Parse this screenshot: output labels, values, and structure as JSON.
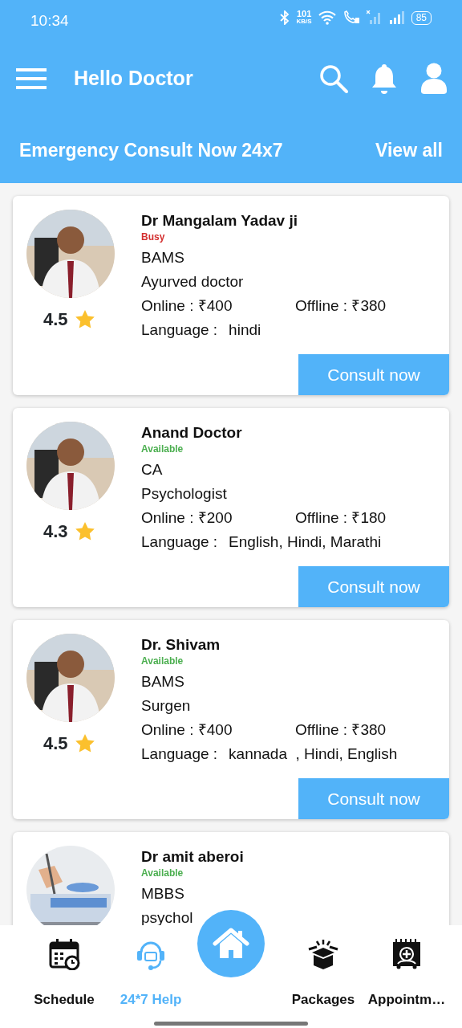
{
  "status_bar": {
    "time": "10:34",
    "speed_value": "101",
    "speed_unit": "KB/S",
    "battery": "85"
  },
  "app_bar": {
    "title": "Hello Doctor"
  },
  "section": {
    "title": "Emergency Consult Now 24x7",
    "link": "View all"
  },
  "doctors": [
    {
      "name": "Dr Mangalam Yadav ji",
      "status": {
        "label": "Busy",
        "color": "#d32f2f"
      },
      "degree": "BAMS",
      "specialty": "Ayurved doctor",
      "online_fee": "Online : ₹400",
      "offline_fee": "Offline : ₹380",
      "language_label": "Language :",
      "languages": "hindi",
      "rating": "4.5",
      "button": "Consult now"
    },
    {
      "name": "Anand Doctor",
      "status": {
        "label": "Available",
        "color": "#4caf50"
      },
      "degree": "CA",
      "specialty": "Psychologist",
      "online_fee": "Online : ₹200",
      "offline_fee": "Offline : ₹180",
      "language_label": "Language :",
      "languages": "English, Hindi, Marathi",
      "rating": "4.3",
      "button": "Consult now"
    },
    {
      "name": "Dr. Shivam",
      "status": {
        "label": "Available",
        "color": "#4caf50"
      },
      "degree": "BAMS",
      "specialty": "Surgen",
      "online_fee": "Online : ₹400",
      "offline_fee": "Offline : ₹380",
      "language_label": "Language :",
      "languages": "kannada  , Hindi, English",
      "rating": "4.5",
      "button": "Consult now"
    },
    {
      "name": "Dr amit aberoi",
      "status": {
        "label": "Available",
        "color": "#4caf50"
      },
      "degree": "MBBS",
      "specialty": "psychol"
    }
  ],
  "bottom_nav": [
    {
      "label": "Schedule",
      "selected": false
    },
    {
      "label": "24*7 Help",
      "selected": true
    },
    {
      "kind": "center"
    },
    {
      "label": "Packages",
      "selected": false
    },
    {
      "label": "Appointm…",
      "selected": false
    }
  ]
}
